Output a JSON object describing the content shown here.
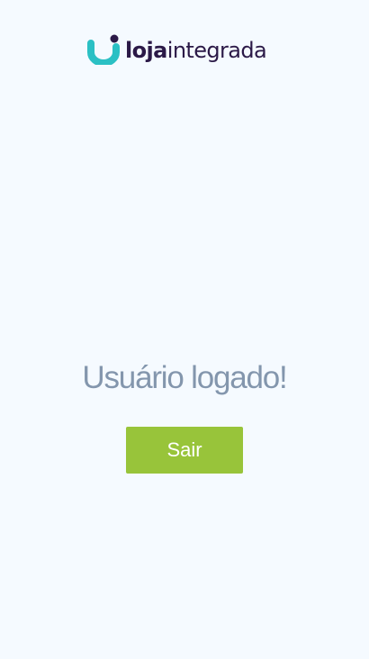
{
  "brand": {
    "name_bold": "loja",
    "name_light": "integrada",
    "icon": "loja-integrada-logo-icon",
    "colors": {
      "mark_teal": "#2bc0c4",
      "mark_dark": "#2b1947",
      "text": "#2b1947"
    }
  },
  "main": {
    "title": "Usuário logado!",
    "logout_label": "Sair"
  },
  "colors": {
    "background": "#f5faff",
    "title": "#8396ad",
    "button": "#98c43a",
    "button_text": "#ffffff"
  }
}
